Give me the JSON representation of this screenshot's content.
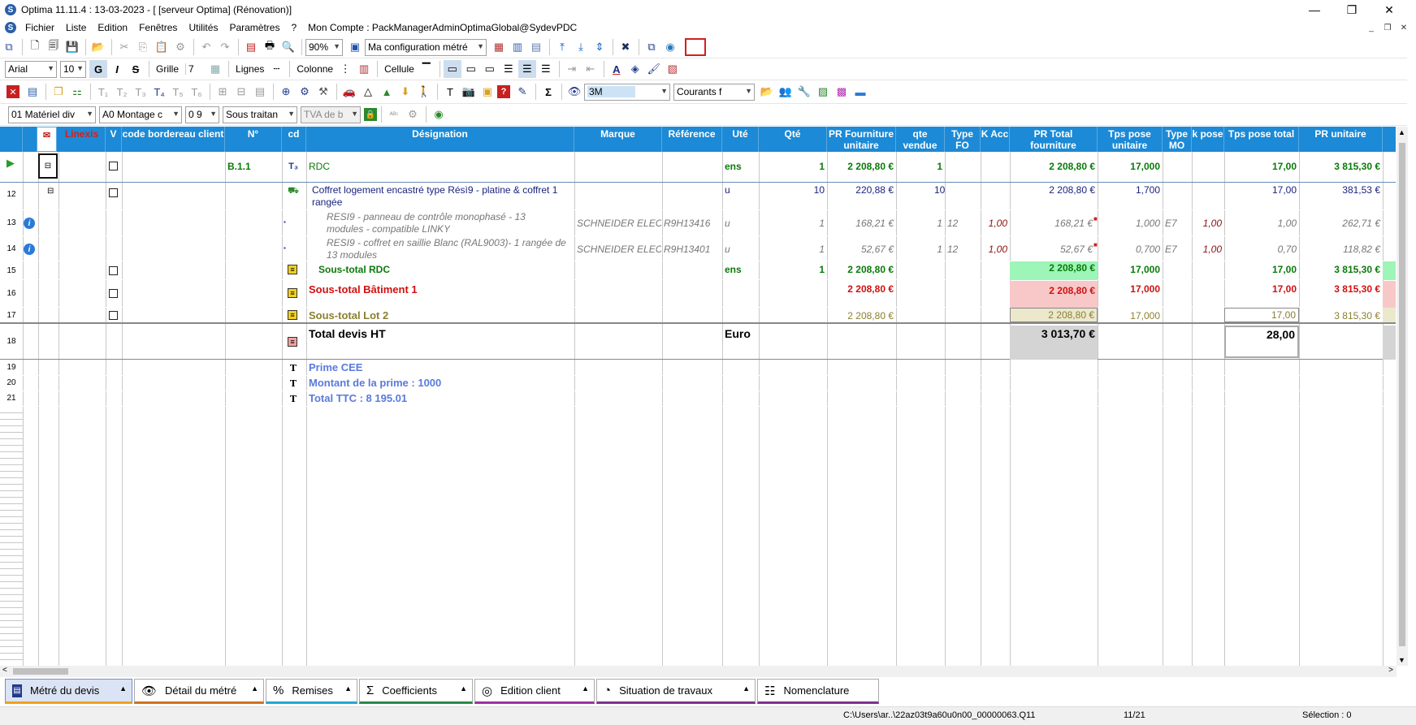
{
  "titlebar": {
    "title": "Optima 11.11.4 : 13-03-2023 - [ [serveur Optima] (Rénovation)]",
    "minimize": "—",
    "restore": "❐",
    "close": "✕"
  },
  "menu": {
    "items": [
      "Fichier",
      "Liste",
      "Edition",
      "Fenêtres",
      "Utilités",
      "Paramètres",
      "?"
    ],
    "account": "Mon Compte : PackManagerAdminOptimaGlobal@SydevPDC"
  },
  "toolbar1": {
    "zoom": "90%",
    "config": "Ma configuration métré"
  },
  "toolbar2": {
    "font": "Arial",
    "size": "10",
    "bold": "G",
    "italic": "I",
    "strike": "S",
    "grille_label": "Grille",
    "grille_value": "7",
    "lignes_label": "Lignes",
    "colonne_label": "Colonne",
    "cellule_label": "Cellule"
  },
  "toolbar3": {
    "combo_3m": "3M",
    "combo_courants": "Courants f"
  },
  "toolbar4": {
    "materiel": "01  Matériel div",
    "montage": "A0  Montage c",
    "pct": "0 9",
    "sous_traitance": "Sous traitan",
    "tva": "TVA de b"
  },
  "columns": {
    "linexis": "Linexis",
    "v": "V",
    "code_bordereau": "code bordereau client",
    "num": "N°",
    "cd": "cd",
    "designation": "Désignation",
    "marque": "Marque",
    "reference": "Référence",
    "ute": "Uté",
    "qte": "Qté",
    "pr_fourniture_unitaire": "PR Fourniture unitaire",
    "qte_vendue": "qte vendue",
    "type_fo": "Type FO",
    "k_acc": "K Acc",
    "pr_total_fourniture": "PR Total fourniture",
    "tps_pose_unitaire": "Tps pose unitaire",
    "type_mo": "Type MO",
    "k_pose": "k pose",
    "tps_pose_total": "Tps pose total",
    "pr_unitaire": "PR unitaire"
  },
  "rows": {
    "r0": {
      "num": "B.1.1",
      "designation": "RDC",
      "ute": "ens",
      "qte": "1",
      "pr_fu": "2 208,80 €",
      "qte_vendue": "1",
      "pr_tf": "2 208,80 €",
      "tps_pu": "17,000",
      "tps_pt": "17,00",
      "pr_u": "3 815,30 €"
    },
    "r12": {
      "rn": "12",
      "designation1": "Coffret logement encastré type Résì9 - platine & coffret 1",
      "designation2": "rangée",
      "ute": "u",
      "qte": "10",
      "pr_fu": "220,88 €",
      "qte_vendue": "10",
      "pr_tf": "2 208,80 €",
      "tps_pu": "1,700",
      "tps_pt": "17,00",
      "pr_u": "381,53 €"
    },
    "r13": {
      "rn": "13",
      "designation1": "RESI9 - panneau de contrôle monophasé - 13",
      "designation2": "modules - compatible LINKY",
      "marque": "SCHNEIDER ELEC",
      "reference": "R9H13416",
      "ute": "u",
      "qte": "1",
      "pr_fu": "168,21 €",
      "qte_vendue": "1",
      "type_fo": "12",
      "k_acc": "1,00",
      "pr_tf": "168,21 €",
      "tps_pu": "1,000",
      "type_mo": "E7",
      "k_pose": "1,00",
      "tps_pt": "1,00",
      "pr_u": "262,71 €"
    },
    "r14": {
      "rn": "14",
      "designation1": "RESI9 - coffret en saillie Blanc (RAL9003)- 1 rangée de",
      "designation2": "13 modules",
      "marque": "SCHNEIDER ELEC",
      "reference": "R9H13401",
      "ute": "u",
      "qte": "1",
      "pr_fu": "52,67 €",
      "qte_vendue": "1",
      "type_fo": "12",
      "k_acc": "1,00",
      "pr_tf": "52,67 €",
      "tps_pu": "0,700",
      "type_mo": "E7",
      "k_pose": "1,00",
      "tps_pt": "0,70",
      "pr_u": "118,82 €"
    },
    "r15": {
      "rn": "15",
      "designation": "Sous-total RDC",
      "ute": "ens",
      "qte": "1",
      "pr_fu": "2 208,80 €",
      "pr_tf": "2 208,80 €",
      "tps_pu": "17,000",
      "tps_pt": "17,00",
      "pr_u": "3 815,30 €"
    },
    "r16": {
      "rn": "16",
      "designation": "Sous-total Bâtiment 1",
      "pr_fu": "2 208,80 €",
      "pr_tf": "2 208,80 €",
      "tps_pu": "17,000",
      "tps_pt": "17,00",
      "pr_u": "3 815,30 €"
    },
    "r17": {
      "rn": "17",
      "designation": "Sous-total Lot 2",
      "pr_fu": "2 208,80 €",
      "pr_tf": "2 208,80 €",
      "tps_pu": "17,000",
      "tps_pt": "17,00",
      "pr_u": "3 815,30 €"
    },
    "r18": {
      "rn": "18",
      "designation": "Total devis HT",
      "ute": "Euro",
      "pr_tf": "3 013,70 €",
      "tps_pt": "28,00"
    },
    "r19": {
      "rn": "19",
      "designation": "Prime CEE"
    },
    "r20": {
      "rn": "20",
      "designation": "Montant  de la prime : 1000"
    },
    "r21": {
      "rn": "21",
      "designation": "Total TTC : 8 195.01"
    }
  },
  "tabs": [
    "Métré du devis",
    "Détail du métré",
    "Remises",
    "Coefficients",
    "Edition client",
    "Situation de travaux",
    "Nomenclature"
  ],
  "status": {
    "path": "C:\\Users\\ar..\\22az03t9a60u0n00_00000063.Q11",
    "pos": "11/21",
    "selection": "Sélection : 0"
  },
  "colors": {
    "header": "#1c8ad6",
    "green": "#0a7a0a",
    "red": "#d01010",
    "olive": "#8a8030",
    "blue": "#5a7adc"
  }
}
